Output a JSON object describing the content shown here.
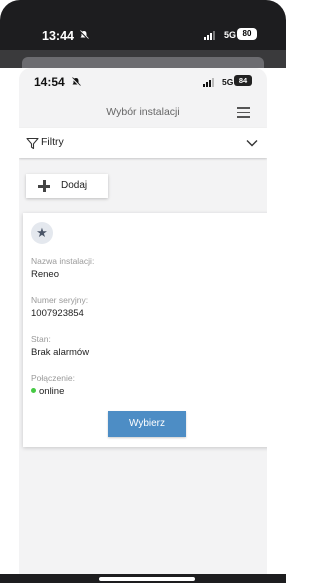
{
  "outer_status": {
    "time": "13:44",
    "network": "5G",
    "battery": "80"
  },
  "inner_status": {
    "time": "14:54",
    "network": "5G",
    "battery": "84"
  },
  "header": {
    "title": "Wybór instalacji",
    "menu_icon": "hamburger-menu-icon"
  },
  "filters": {
    "label": "Filtry",
    "icon": "filter-funnel-icon",
    "toggle_icon": "chevron-down-icon"
  },
  "add_button": {
    "label": "Dodaj",
    "icon": "plus-icon"
  },
  "installation": {
    "favorite_icon": "star-icon",
    "name_label": "Nazwa instalacji:",
    "name": "Reneo",
    "serial_label": "Numer seryjny:",
    "serial": "1007923854",
    "state_label": "Stan:",
    "state": "Brak alarmów",
    "connection_label": "Połączenie:",
    "connection": "online",
    "connection_color": "#46c944",
    "select_label": "Wybierz",
    "select_color": "#4d8dc5"
  }
}
